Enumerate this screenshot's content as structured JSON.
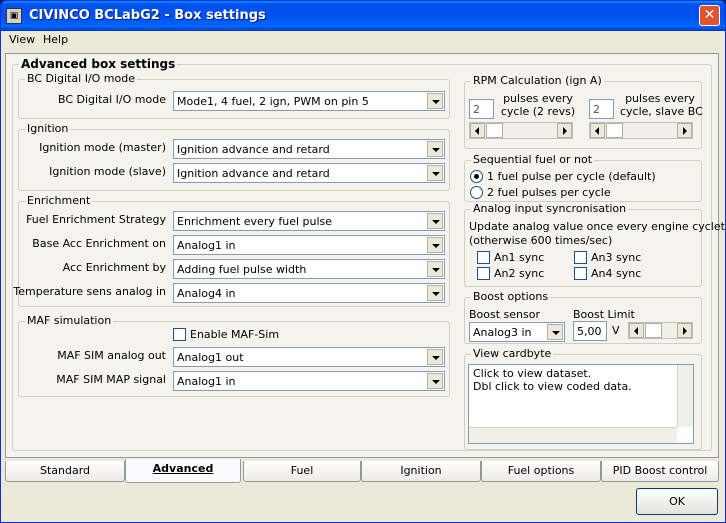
{
  "window": {
    "title": "CIVINCO  BCLabG2 - Box settings",
    "close_symbol": "✕"
  },
  "menu": [
    "View",
    "Help"
  ],
  "panel_title": "Advanced box settings",
  "bc_io": {
    "group": "BC Digital I/O mode",
    "label": "BC Digital I/O mode",
    "value": "Mode1, 4 fuel, 2 ign, PWM on pin 5"
  },
  "ignition": {
    "group": "Ignition",
    "master_label": "Ignition mode (master)",
    "master_value": "Ignition advance and retard",
    "slave_label": "Ignition mode (slave)",
    "slave_value": "Ignition advance and retard"
  },
  "enrichment": {
    "group": "Enrichment",
    "strategy_label": "Fuel Enrichment Strategy",
    "strategy_value": "Enrichment every fuel pulse",
    "base_label": "Base Acc Enrichment on",
    "base_value": "Analog1 in",
    "acc_by_label": "Acc Enrichment by",
    "acc_by_value": "Adding fuel pulse width",
    "temp_label": "Temperature sens analog in",
    "temp_value": "Analog4 in"
  },
  "maf": {
    "group": "MAF simulation",
    "enable_label": "Enable MAF-Sim",
    "analog_label": "MAF SIM analog out",
    "analog_value": "Analog1 out",
    "map_label": "MAF SIM MAP signal",
    "map_value": "Analog1 in"
  },
  "rpm": {
    "group": "RPM Calculation (ign A)",
    "master_value": "2",
    "master_text1": "pulses every",
    "master_text2": "cycle (2 revs)",
    "slave_value": "2",
    "slave_text1": "pulses every",
    "slave_text2": "cycle, slave BC"
  },
  "seq": {
    "group": "Sequential fuel or not",
    "option1": "1 fuel pulse per cycle (default)",
    "option2": "2 fuel pulses per cycle",
    "selected": 1
  },
  "analog_sync": {
    "group": "Analog input syncronisation",
    "desc1": "Update analog value once every engine cyclet",
    "desc2": "(otherwise 600 times/sec)",
    "an1": "An1 sync",
    "an2": "An2 sync",
    "an3": "An3 sync",
    "an4": "An4 sync"
  },
  "boost": {
    "group": "Boost options",
    "sensor_label": "Boost sensor",
    "sensor_value": "Analog3 in",
    "limit_label": "Boost Limit",
    "limit_value": "5,00",
    "unit": "V"
  },
  "cardbyte": {
    "group": "View cardbyte",
    "line1": "Click to view dataset.",
    "line2": "Dbl click to view coded data."
  },
  "tabs": [
    "Standard",
    "Advanced",
    "Fuel",
    "Ignition",
    "Fuel options",
    "PID Boost control"
  ],
  "active_tab": "Advanced",
  "ok_label": "OK"
}
